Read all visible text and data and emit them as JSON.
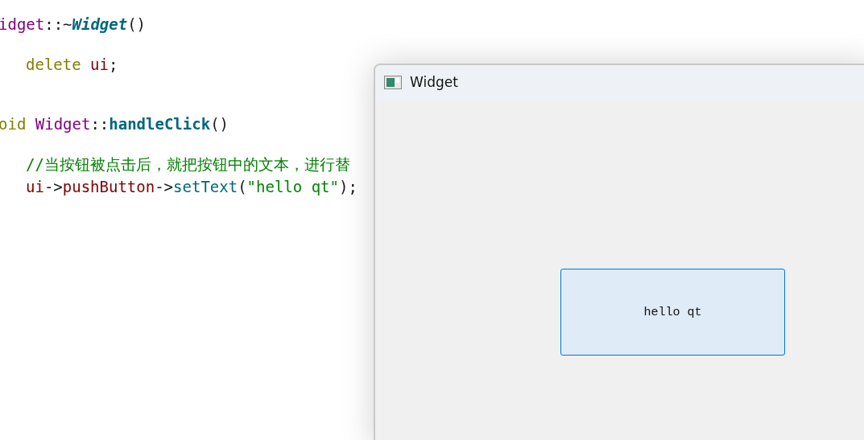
{
  "editor": {
    "lines": [
      {
        "tokens": [
          {
            "text": "idget",
            "kind": "type"
          },
          {
            "text": "::~",
            "kind": "punct"
          },
          {
            "text": "Widget",
            "kind": "func-italic"
          },
          {
            "text": "()",
            "kind": "punct"
          }
        ]
      },
      {
        "tokens": [
          {
            "text": "delete",
            "kind": "keyword"
          },
          {
            "text": " ui",
            "kind": "var"
          },
          {
            "text": ";",
            "kind": "punct"
          }
        ]
      },
      {
        "tokens": [
          {
            "text": "oid",
            "kind": "keyword"
          },
          {
            "text": " Widget",
            "kind": "type"
          },
          {
            "text": "::",
            "kind": "punct"
          },
          {
            "text": "handleClick",
            "kind": "func"
          },
          {
            "text": "()",
            "kind": "punct"
          }
        ]
      },
      {
        "tokens": [
          {
            "text": "//当按钮被点击后，就把按钮中的文本，进行替",
            "kind": "comment"
          }
        ]
      },
      {
        "tokens": [
          {
            "text": "ui",
            "kind": "var"
          },
          {
            "text": "->",
            "kind": "punct"
          },
          {
            "text": "pushButton",
            "kind": "var"
          },
          {
            "text": "->",
            "kind": "punct"
          },
          {
            "text": "setText",
            "kind": "method"
          },
          {
            "text": "(",
            "kind": "punct"
          },
          {
            "text": "\"hello qt\"",
            "kind": "string"
          },
          {
            "text": ");",
            "kind": "punct"
          }
        ]
      }
    ]
  },
  "window": {
    "title": "Widget",
    "button": {
      "label": "hello qt"
    }
  }
}
